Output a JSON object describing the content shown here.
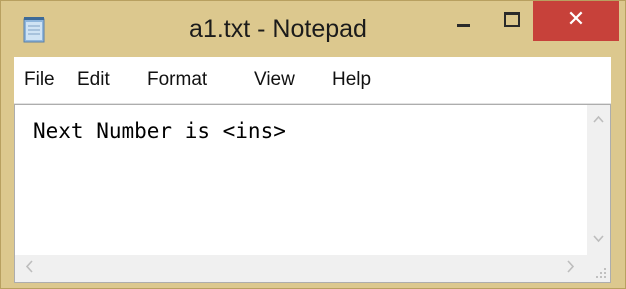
{
  "window": {
    "title": "a1.txt - Notepad",
    "close_symbol": "✕",
    "icons": {
      "app": "notepad-icon",
      "minimize": "minimize-icon",
      "maximize": "maximize-icon",
      "close": "close-icon"
    }
  },
  "menu": {
    "file": "File",
    "edit": "Edit",
    "format": "Format",
    "view": "View",
    "help": "Help"
  },
  "editor": {
    "content": "Next Number is <ins>"
  },
  "scrollbars": {
    "up_arrow": "^",
    "down_arrow": "v",
    "left_arrow": "<",
    "right_arrow": ">"
  },
  "colors": {
    "frame": "#dcc88e",
    "close_button": "#c7413a"
  }
}
